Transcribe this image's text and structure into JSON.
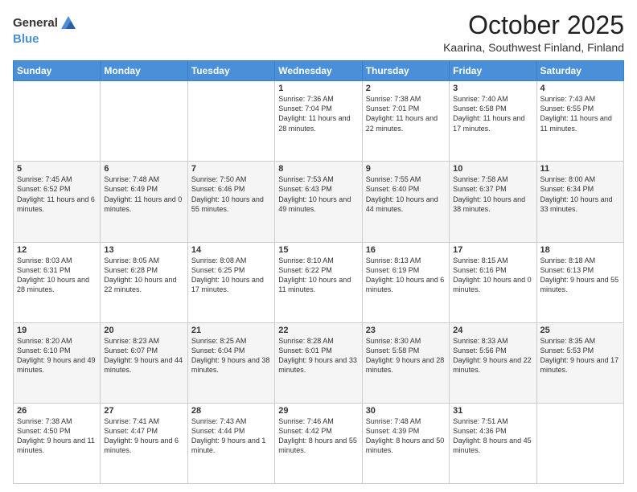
{
  "logo": {
    "general": "General",
    "blue": "Blue"
  },
  "header": {
    "month": "October 2025",
    "location": "Kaarina, Southwest Finland, Finland"
  },
  "weekdays": [
    "Sunday",
    "Monday",
    "Tuesday",
    "Wednesday",
    "Thursday",
    "Friday",
    "Saturday"
  ],
  "weeks": [
    [
      {
        "day": "",
        "sunrise": "",
        "sunset": "",
        "daylight": ""
      },
      {
        "day": "",
        "sunrise": "",
        "sunset": "",
        "daylight": ""
      },
      {
        "day": "",
        "sunrise": "",
        "sunset": "",
        "daylight": ""
      },
      {
        "day": "1",
        "sunrise": "Sunrise: 7:36 AM",
        "sunset": "Sunset: 7:04 PM",
        "daylight": "Daylight: 11 hours and 28 minutes."
      },
      {
        "day": "2",
        "sunrise": "Sunrise: 7:38 AM",
        "sunset": "Sunset: 7:01 PM",
        "daylight": "Daylight: 11 hours and 22 minutes."
      },
      {
        "day": "3",
        "sunrise": "Sunrise: 7:40 AM",
        "sunset": "Sunset: 6:58 PM",
        "daylight": "Daylight: 11 hours and 17 minutes."
      },
      {
        "day": "4",
        "sunrise": "Sunrise: 7:43 AM",
        "sunset": "Sunset: 6:55 PM",
        "daylight": "Daylight: 11 hours and 11 minutes."
      }
    ],
    [
      {
        "day": "5",
        "sunrise": "Sunrise: 7:45 AM",
        "sunset": "Sunset: 6:52 PM",
        "daylight": "Daylight: 11 hours and 6 minutes."
      },
      {
        "day": "6",
        "sunrise": "Sunrise: 7:48 AM",
        "sunset": "Sunset: 6:49 PM",
        "daylight": "Daylight: 11 hours and 0 minutes."
      },
      {
        "day": "7",
        "sunrise": "Sunrise: 7:50 AM",
        "sunset": "Sunset: 6:46 PM",
        "daylight": "Daylight: 10 hours and 55 minutes."
      },
      {
        "day": "8",
        "sunrise": "Sunrise: 7:53 AM",
        "sunset": "Sunset: 6:43 PM",
        "daylight": "Daylight: 10 hours and 49 minutes."
      },
      {
        "day": "9",
        "sunrise": "Sunrise: 7:55 AM",
        "sunset": "Sunset: 6:40 PM",
        "daylight": "Daylight: 10 hours and 44 minutes."
      },
      {
        "day": "10",
        "sunrise": "Sunrise: 7:58 AM",
        "sunset": "Sunset: 6:37 PM",
        "daylight": "Daylight: 10 hours and 38 minutes."
      },
      {
        "day": "11",
        "sunrise": "Sunrise: 8:00 AM",
        "sunset": "Sunset: 6:34 PM",
        "daylight": "Daylight: 10 hours and 33 minutes."
      }
    ],
    [
      {
        "day": "12",
        "sunrise": "Sunrise: 8:03 AM",
        "sunset": "Sunset: 6:31 PM",
        "daylight": "Daylight: 10 hours and 28 minutes."
      },
      {
        "day": "13",
        "sunrise": "Sunrise: 8:05 AM",
        "sunset": "Sunset: 6:28 PM",
        "daylight": "Daylight: 10 hours and 22 minutes."
      },
      {
        "day": "14",
        "sunrise": "Sunrise: 8:08 AM",
        "sunset": "Sunset: 6:25 PM",
        "daylight": "Daylight: 10 hours and 17 minutes."
      },
      {
        "day": "15",
        "sunrise": "Sunrise: 8:10 AM",
        "sunset": "Sunset: 6:22 PM",
        "daylight": "Daylight: 10 hours and 11 minutes."
      },
      {
        "day": "16",
        "sunrise": "Sunrise: 8:13 AM",
        "sunset": "Sunset: 6:19 PM",
        "daylight": "Daylight: 10 hours and 6 minutes."
      },
      {
        "day": "17",
        "sunrise": "Sunrise: 8:15 AM",
        "sunset": "Sunset: 6:16 PM",
        "daylight": "Daylight: 10 hours and 0 minutes."
      },
      {
        "day": "18",
        "sunrise": "Sunrise: 8:18 AM",
        "sunset": "Sunset: 6:13 PM",
        "daylight": "Daylight: 9 hours and 55 minutes."
      }
    ],
    [
      {
        "day": "19",
        "sunrise": "Sunrise: 8:20 AM",
        "sunset": "Sunset: 6:10 PM",
        "daylight": "Daylight: 9 hours and 49 minutes."
      },
      {
        "day": "20",
        "sunrise": "Sunrise: 8:23 AM",
        "sunset": "Sunset: 6:07 PM",
        "daylight": "Daylight: 9 hours and 44 minutes."
      },
      {
        "day": "21",
        "sunrise": "Sunrise: 8:25 AM",
        "sunset": "Sunset: 6:04 PM",
        "daylight": "Daylight: 9 hours and 38 minutes."
      },
      {
        "day": "22",
        "sunrise": "Sunrise: 8:28 AM",
        "sunset": "Sunset: 6:01 PM",
        "daylight": "Daylight: 9 hours and 33 minutes."
      },
      {
        "day": "23",
        "sunrise": "Sunrise: 8:30 AM",
        "sunset": "Sunset: 5:58 PM",
        "daylight": "Daylight: 9 hours and 28 minutes."
      },
      {
        "day": "24",
        "sunrise": "Sunrise: 8:33 AM",
        "sunset": "Sunset: 5:56 PM",
        "daylight": "Daylight: 9 hours and 22 minutes."
      },
      {
        "day": "25",
        "sunrise": "Sunrise: 8:35 AM",
        "sunset": "Sunset: 5:53 PM",
        "daylight": "Daylight: 9 hours and 17 minutes."
      }
    ],
    [
      {
        "day": "26",
        "sunrise": "Sunrise: 7:38 AM",
        "sunset": "Sunset: 4:50 PM",
        "daylight": "Daylight: 9 hours and 11 minutes."
      },
      {
        "day": "27",
        "sunrise": "Sunrise: 7:41 AM",
        "sunset": "Sunset: 4:47 PM",
        "daylight": "Daylight: 9 hours and 6 minutes."
      },
      {
        "day": "28",
        "sunrise": "Sunrise: 7:43 AM",
        "sunset": "Sunset: 4:44 PM",
        "daylight": "Daylight: 9 hours and 1 minute."
      },
      {
        "day": "29",
        "sunrise": "Sunrise: 7:46 AM",
        "sunset": "Sunset: 4:42 PM",
        "daylight": "Daylight: 8 hours and 55 minutes."
      },
      {
        "day": "30",
        "sunrise": "Sunrise: 7:48 AM",
        "sunset": "Sunset: 4:39 PM",
        "daylight": "Daylight: 8 hours and 50 minutes."
      },
      {
        "day": "31",
        "sunrise": "Sunrise: 7:51 AM",
        "sunset": "Sunset: 4:36 PM",
        "daylight": "Daylight: 8 hours and 45 minutes."
      },
      {
        "day": "",
        "sunrise": "",
        "sunset": "",
        "daylight": ""
      }
    ]
  ]
}
